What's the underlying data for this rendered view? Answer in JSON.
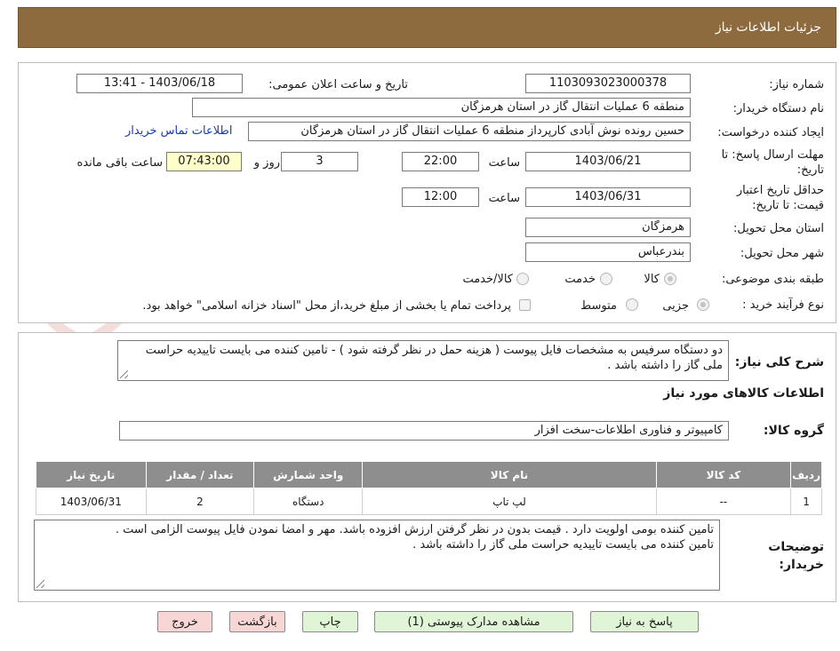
{
  "header": {
    "title": "جزئیات اطلاعات نیاز"
  },
  "watermark": {
    "text": "AriaTender.net"
  },
  "form": {
    "need_number_label": "شماره نیاز:",
    "need_number": "1103093023000378",
    "announce_label": "تاریخ و ساعت اعلان عمومی:",
    "announce_value": "1403/06/18 - 13:41",
    "buyer_org_label": "نام دستگاه خریدار:",
    "buyer_org": "منطقه 6 عملیات انتقال گاز در استان هرمزگان",
    "requester_label": "ایجاد کننده درخواست:",
    "requester": "حسین رونده نوش آبادی کارپرداز منطقه 6 عملیات انتقال گاز در استان هرمزگان",
    "contact_link": "اطلاعات تماس خریدار",
    "deadline_label": "مهلت ارسال پاسخ: تا تاریخ:",
    "deadline_date": "1403/06/21",
    "time_label": "ساعت",
    "deadline_time": "22:00",
    "days": "3",
    "days_label": "روز و",
    "remaining": "07:43:00",
    "remaining_label": "ساعت باقی مانده",
    "validity_label": "حداقل تاریخ اعتبار قیمت: تا تاریخ:",
    "validity_date": "1403/06/31",
    "validity_time_label": "ساعت",
    "validity_time": "12:00",
    "province_label": "استان محل تحویل:",
    "province": "هرمزگان",
    "city_label": "شهر محل تحویل:",
    "city": "بندرعباس",
    "category_label": "طبقه بندی موضوعی:",
    "category_options": [
      "کالا",
      "خدمت",
      "کالا/خدمت"
    ],
    "category_selected": "کالا",
    "process_label": "نوع فرآیند خرید :",
    "process_options": [
      "جزیی",
      "متوسط"
    ],
    "process_selected": "جزیی",
    "payment_note": "پرداخت تمام یا بخشی از مبلغ خرید،از محل \"اسناد خزانه اسلامی\" خواهد بود."
  },
  "summary": {
    "label": "شرح کلی نیاز:",
    "text": "دو دستگاه سرفیس به مشخصات فایل پیوست ( هزینه حمل در نظر گرفته شود ) - تامین کننده می بایست تاییدیه حراست ملی گاز را داشته باشد ."
  },
  "items_section": {
    "title": "اطلاعات کالاهای مورد نیاز",
    "group_label": "گروه کالا:",
    "group_value": "کامپیوتر و فناوری اطلاعات-سخت افزار",
    "columns": [
      "ردیف",
      "کد کالا",
      "نام کالا",
      "واحد شمارش",
      "تعداد / مقدار",
      "تاریخ نیاز"
    ],
    "rows": [
      {
        "row": "1",
        "code": "--",
        "name": "لپ تاپ",
        "unit": "دستگاه",
        "qty": "2",
        "date": "1403/06/31"
      }
    ]
  },
  "notes": {
    "label": "توضیحات خریدار:",
    "line1": "تامین کننده بومی اولویت دارد . قیمت بدون در نظر گرفتن ارزش افزوده باشد. مهر و امضا نمودن فایل پیوست الزامی است .",
    "line2": "تامین کننده می بایست تاییدیه حراست ملی گاز را داشته باشد ."
  },
  "buttons": {
    "reply": "پاسخ به نیاز",
    "attachments": "مشاهده مدارک پیوستی (1)",
    "print": "چاپ",
    "back": "بازگشت",
    "exit": "خروج"
  },
  "colors": {
    "header": "#8d6b3f",
    "table_header": "#8e8e8e",
    "green_button": "#dff5d6",
    "pink_button": "#f9d6d6",
    "highlight": "#ffffcc"
  }
}
